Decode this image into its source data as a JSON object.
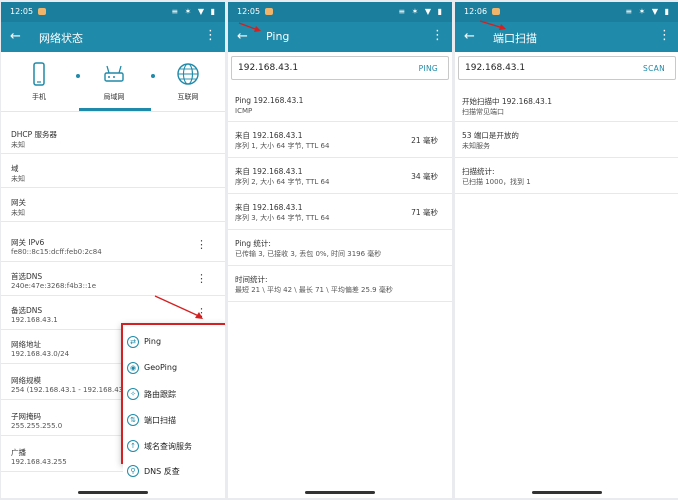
{
  "colors": {
    "accent": "#1f8aa9",
    "status_bar": "#1a7e9c",
    "highlight_red": "#d42020"
  },
  "icons": {
    "back": "arrow-left-icon",
    "more": "more-vertical-icon",
    "phone": "phone-icon",
    "lan": "lan-router-icon",
    "globe": "globe-icon"
  },
  "screen1": {
    "status_time": "12:05",
    "status_icons": "≡ ✶ ▼ ▮",
    "title": "网络状态",
    "nav": [
      "手机",
      "局域网",
      "互联网"
    ],
    "rows": [
      {
        "label": "DHCP 服务器",
        "value": "未知"
      },
      {
        "label": "域",
        "value": "未知"
      },
      {
        "label": "网关",
        "value": "未知"
      },
      {
        "label": "网关 IPv6",
        "value": "fe80::8c15:dcff:feb0:2c84"
      },
      {
        "label": "首选DNS",
        "value": "240e:47e:3268:f4b3::1e"
      },
      {
        "label": "备选DNS",
        "value": "192.168.43.1"
      },
      {
        "label": "网络地址",
        "value": "192.168.43.0/24"
      },
      {
        "label": "网络规模",
        "value": "254 (192.168.43.1 - 192.168.43.2..."
      },
      {
        "label": "子网掩码",
        "value": "255.255.255.0"
      },
      {
        "label": "广播",
        "value": "192.168.43.255"
      }
    ],
    "menu": [
      "Ping",
      "GeoPing",
      "路由跟踪",
      "端口扫描",
      "域名查询服务",
      "DNS 反查"
    ]
  },
  "screen2": {
    "status_time": "12:05",
    "status_icons": "≡ ✶ ▼ ▮",
    "title": "Ping",
    "input_value": "192.168.43.1",
    "button": "PING",
    "header_line1": "Ping 192.168.43.1",
    "header_line2": "ICMP",
    "results": [
      {
        "l1": "来自 192.168.43.1",
        "l2": "序列 1, 大小 64 字节, TTL 64",
        "ms": "21 毫秒"
      },
      {
        "l1": "来自 192.168.43.1",
        "l2": "序列 2, 大小 64 字节, TTL 64",
        "ms": "34 毫秒"
      },
      {
        "l1": "来自 192.168.43.1",
        "l2": "序列 3, 大小 64 字节, TTL 64",
        "ms": "71 毫秒"
      }
    ],
    "stats_title": "Ping 统计:",
    "stats_value": "已传输 3, 已接收 3, 丢包 0%, 时间 3196 毫秒",
    "timing_title": "时间统计:",
    "timing_value": "最短 21 \\ 平均 42 \\ 最长 71 \\ 平均偏差 25.9 毫秒"
  },
  "screen3": {
    "status_time": "12:06",
    "status_icons": "≡ ✶ ▼ ▮",
    "title": "端口扫描",
    "input_value": "192.168.43.1",
    "button": "SCAN",
    "blocks": [
      {
        "l1": "开始扫描中 192.168.43.1",
        "l2": "扫描常见端口"
      },
      {
        "l1": "53 端口是开放的",
        "l2": "未知服务"
      },
      {
        "l1": "扫描统计:",
        "l2": "已扫描 1000，找到 1"
      }
    ]
  }
}
